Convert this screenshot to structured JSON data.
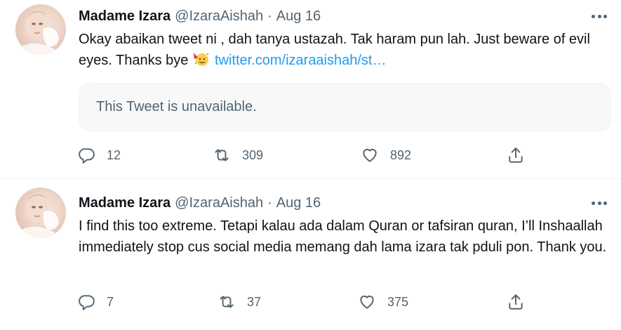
{
  "colors": {
    "text": "#0f1419",
    "secondary": "#536471",
    "link": "#1d9bf0",
    "quote_bg": "#f7f9f9",
    "divider": "#eff3f4"
  },
  "tweets": [
    {
      "author": {
        "name": "Madame Izara",
        "handle": "@IzaraAishah",
        "separator": "·",
        "date": "Aug 16",
        "avatar_icon": "profile-photo"
      },
      "text": "Okay abaikan tweet ni , dah tanya ustazah. Tak haram pun lah. Just beware of evil eyes. Thanks bye ",
      "emoji_icon": "partying-face-emoji",
      "link": "twitter.com/izaraaishah/st…",
      "quote": "This Tweet is unavailable.",
      "replies": "12",
      "retweets": "309",
      "likes": "892"
    },
    {
      "author": {
        "name": "Madame Izara",
        "handle": "@IzaraAishah",
        "separator": "·",
        "date": "Aug 16",
        "avatar_icon": "profile-photo"
      },
      "text": "I find this too extreme. Tetapi kalau ada dalam Quran or tafsiran quran,  I’ll Inshaallah  immediately stop cus social media memang dah lama izara tak pduli pon. Thank you.",
      "replies": "7",
      "retweets": "37",
      "likes": "375"
    }
  ]
}
